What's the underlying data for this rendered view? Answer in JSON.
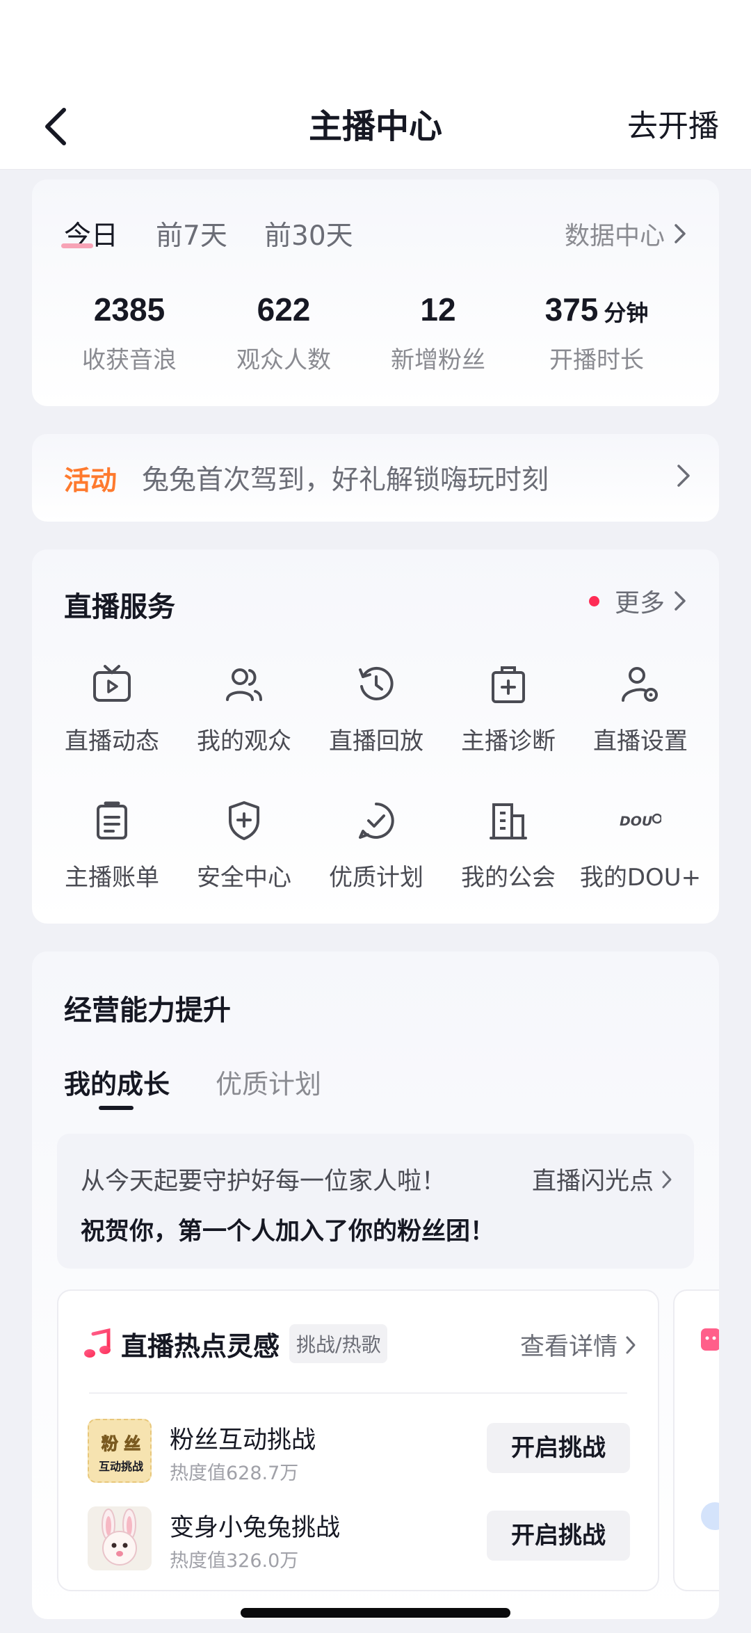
{
  "nav": {
    "title": "主播中心",
    "action": "去开播"
  },
  "stats": {
    "tabs": [
      "今日",
      "前7天",
      "前30天"
    ],
    "data_center": "数据中心",
    "items": [
      {
        "value": "2385",
        "label": "收获音浪"
      },
      {
        "value": "622",
        "label": "观众人数"
      },
      {
        "value": "12",
        "label": "新增粉丝"
      },
      {
        "value": "375",
        "unit": "分钟",
        "label": "开播时长"
      }
    ]
  },
  "activity": {
    "tag": "活动",
    "text": "兔兔首次驾到，好礼解锁嗨玩时刻"
  },
  "services": {
    "title": "直播服务",
    "more": "更多",
    "items": [
      {
        "label": "直播动态",
        "icon": "tv-play-icon"
      },
      {
        "label": "我的观众",
        "icon": "users-icon"
      },
      {
        "label": "直播回放",
        "icon": "history-icon"
      },
      {
        "label": "主播诊断",
        "icon": "medkit-icon"
      },
      {
        "label": "直播设置",
        "icon": "user-settings-icon"
      },
      {
        "label": "主播账单",
        "icon": "clipboard-icon"
      },
      {
        "label": "安全中心",
        "icon": "shield-plus-icon"
      },
      {
        "label": "优质计划",
        "icon": "check-bubble-icon"
      },
      {
        "label": "我的公会",
        "icon": "building-icon"
      },
      {
        "label": "我的DOU+",
        "icon": "dou-logo-icon",
        "icon_text": "DOU"
      }
    ]
  },
  "growth": {
    "title": "经营能力提升",
    "tabs": [
      "我的成长",
      "优质计划"
    ],
    "highlight": {
      "line1": "从今天起要守护好每一位家人啦！",
      "line2": "祝贺你，第一个人加入了你的粉丝团！",
      "link": "直播闪光点"
    },
    "hot": {
      "title": "直播热点灵感",
      "badge": "挑战/热歌",
      "link": "查看详情",
      "challenges": [
        {
          "name": "粉丝互动挑战",
          "heat": "热度值628.7万",
          "button": "开启挑战",
          "thumb_line1": "粉 丝",
          "thumb_line2": "互动挑战"
        },
        {
          "name": "变身小兔兔挑战",
          "heat": "热度值326.0万",
          "button": "开启挑战"
        }
      ]
    }
  },
  "colors": {
    "accent": "#fe2c55",
    "activity": "#fe7a2e",
    "background": "#f0f1f6"
  }
}
